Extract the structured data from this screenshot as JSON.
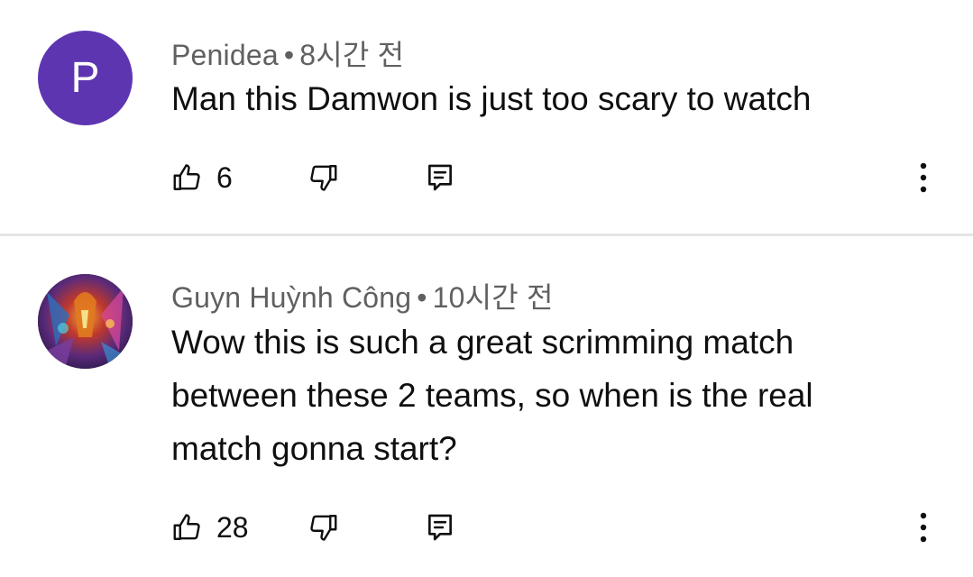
{
  "comments": [
    {
      "author": "Penidea",
      "separator": "•",
      "time": "8시간 전",
      "avatar_letter": "P",
      "avatar_color": "#5e35b1",
      "text": "Man this Damwon is just too scary to watch",
      "likes": "6",
      "icons": {
        "like": "thumbs-up-icon",
        "dislike": "thumbs-down-icon",
        "reply": "reply-icon",
        "more": "more-vert-icon"
      }
    },
    {
      "author": "Guyn Huỳnh Công",
      "separator": "•",
      "time": "10시간 전",
      "avatar_letter": "",
      "text": "Wow this is such a great scrimming match between these 2 teams, so when is the real match gonna start?",
      "likes": "28",
      "icons": {
        "like": "thumbs-up-icon",
        "dislike": "thumbs-down-icon",
        "reply": "reply-icon",
        "more": "more-vert-icon"
      }
    }
  ]
}
